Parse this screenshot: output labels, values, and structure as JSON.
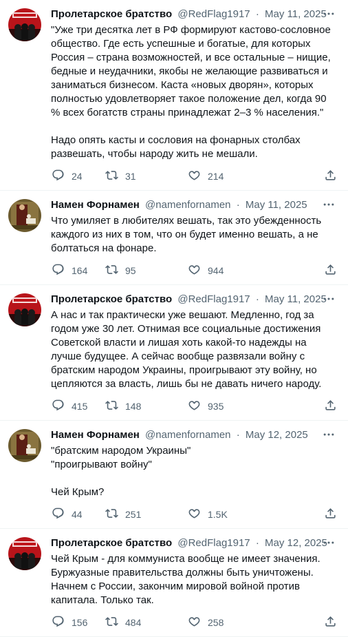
{
  "tweets": [
    {
      "author": "Пролетарское братство",
      "handle": "@RedFlag1917",
      "sep": "·",
      "date": "May 11, 2025",
      "text": "\"Уже три десятка лет в РФ формируют кастово-сословное общество. Где есть успешные и богатые, для которых Россия – страна возможностей, и все остальные – нищие, бедные и неудачники, якобы не желающие развиваться и заниматься бизнесом. Каста «новых дворян», которых полностью удовлетворяет такое положение дел, когда 90 % всех богатств страны принадлежат 2–3 % населения.\"\n\nНадо опять касты и сословия на фонарных столбах развешать, чтобы народу жить не мешали.",
      "replies": "24",
      "retweets": "31",
      "likes": "214",
      "avatar": "red-flag-avatar"
    },
    {
      "author": "Намен Форнамен",
      "handle": "@namenfornamen",
      "sep": "·",
      "date": "May 11, 2025",
      "text": "Что умиляет в любителях вешать, так это убежденность каждого из них в том, что он будет именно вешать, а не болтаться на фонаре.",
      "replies": "164",
      "retweets": "95",
      "likes": "944",
      "avatar": "painting-avatar"
    },
    {
      "author": "Пролетарское братство",
      "handle": "@RedFlag1917",
      "sep": "·",
      "date": "May 11, 2025",
      "text": "А нас и так практически уже вешают. Медленно, год за годом уже 30 лет. Отнимая все социальные достижения Советской власти и лишая хоть какой-то надежды на лучше будущее. А сейчас вообще развязали войну с братским народом Украины, проигрывают эту войну, но цепляются за власть, лишь бы не давать ничего народу.",
      "replies": "415",
      "retweets": "148",
      "likes": "935",
      "avatar": "red-flag-avatar"
    },
    {
      "author": "Намен Форнамен",
      "handle": "@namenfornamen",
      "sep": "·",
      "date": "May 12, 2025",
      "text": "\"братским народом Украины\"\n\"проигрывают войну\"\n\nЧей Крым?",
      "replies": "44",
      "retweets": "251",
      "likes": "1.5K",
      "avatar": "painting-avatar"
    },
    {
      "author": "Пролетарское братство",
      "handle": "@RedFlag1917",
      "sep": "·",
      "date": "May 12, 2025",
      "text": "Чей Крым - для коммуниста вообще не имеет значения. Буржуазные правительства должны быть уничтожены. Начнем с России, закончим мировой войной против капитала. Только так.",
      "replies": "156",
      "retweets": "484",
      "likes": "258",
      "avatar": "red-flag-avatar"
    }
  ],
  "colors": {
    "text": "#0f1419",
    "secondary": "#536471",
    "divider": "#eff3f4"
  }
}
